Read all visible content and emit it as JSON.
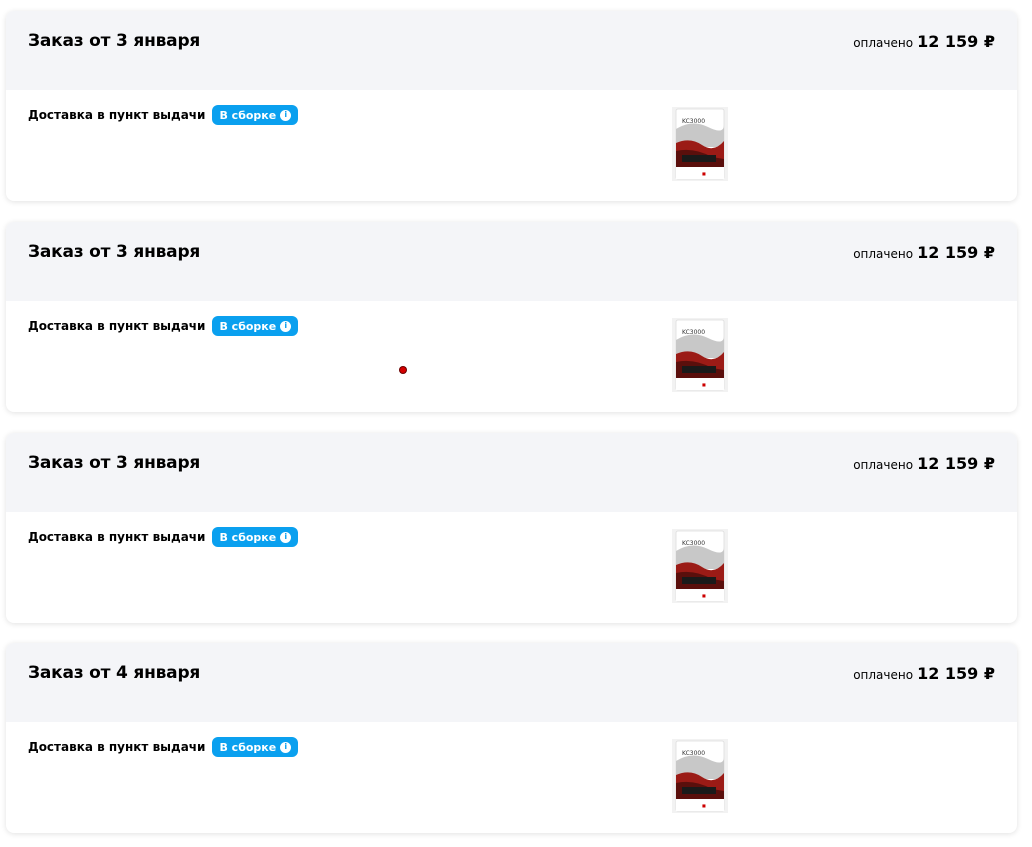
{
  "orders": [
    {
      "title": "Заказ от 3 января",
      "paid_label": "оплачено",
      "paid_amount": "12 159 ₽",
      "delivery_label": "Доставка в пункт выдачи",
      "status": "В сборке",
      "product_icon": "ssd-package-image",
      "product_text": "KC3000"
    },
    {
      "title": "Заказ от 3 января",
      "paid_label": "оплачено",
      "paid_amount": "12 159 ₽",
      "delivery_label": "Доставка в пункт выдачи",
      "status": "В сборке",
      "product_icon": "ssd-package-image",
      "product_text": "KC3000"
    },
    {
      "title": "Заказ от 3 января",
      "paid_label": "оплачено",
      "paid_amount": "12 159 ₽",
      "delivery_label": "Доставка в пункт выдачи",
      "status": "В сборке",
      "product_icon": "ssd-package-image",
      "product_text": "KC3000"
    },
    {
      "title": "Заказ от 4 января",
      "paid_label": "оплачено",
      "paid_amount": "12 159 ₽",
      "delivery_label": "Доставка в пункт выдачи",
      "status": "В сборке",
      "product_icon": "ssd-package-image",
      "product_text": "KC3000"
    }
  ],
  "colors": {
    "header_bg": "#f4f5f8",
    "status_badge": "#0aa0ef",
    "cursor": "#d40000"
  }
}
